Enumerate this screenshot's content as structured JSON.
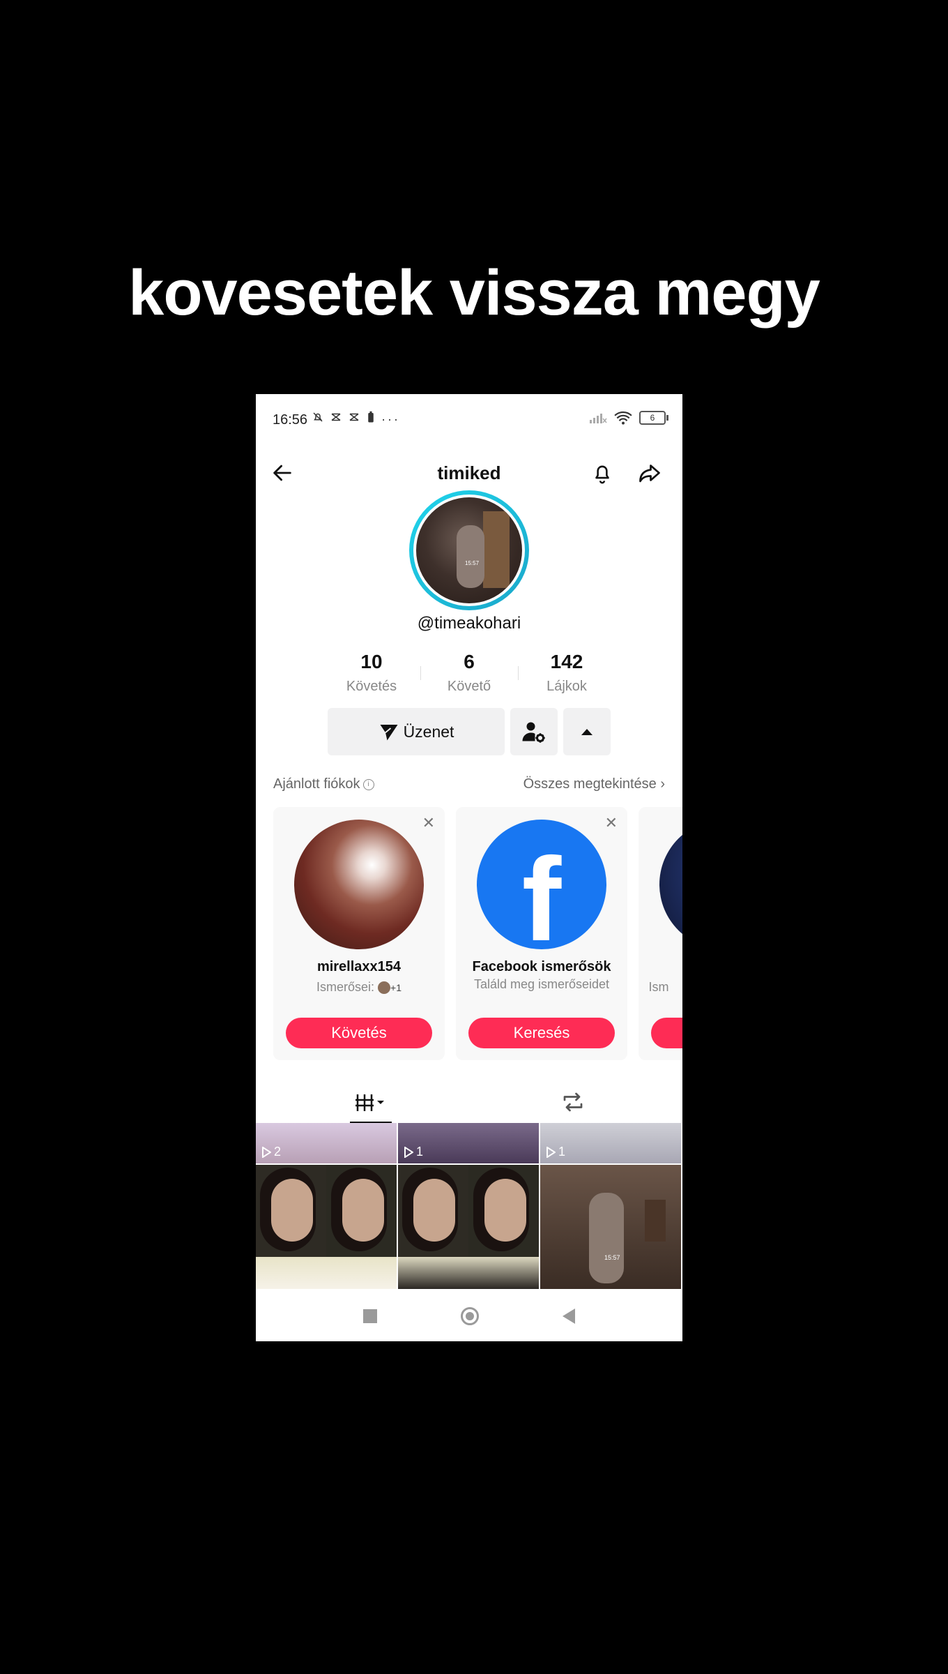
{
  "caption": "kovesetek vissza megy",
  "status": {
    "time": "16:56",
    "battery": "6"
  },
  "profile": {
    "title": "timiked",
    "handle": "@timeakohari",
    "avatar_timestamp": "15:57",
    "stats": [
      {
        "value": "10",
        "label": "Követés"
      },
      {
        "value": "6",
        "label": "Követő"
      },
      {
        "value": "142",
        "label": "Lájkok"
      }
    ],
    "message_label": "Üzenet"
  },
  "suggested": {
    "title": "Ajánlott fiókok",
    "see_all": "Összes megtekintése",
    "cards": [
      {
        "name": "mirellaxx154",
        "sub_prefix": "Ismerősei:",
        "sub_extra": "+1",
        "button": "Követés"
      },
      {
        "name": "Facebook ismerősök",
        "sub": "Találd meg ismerőseidet",
        "button": "Keresés"
      },
      {
        "name": "",
        "sub": "Ism"
      }
    ]
  },
  "grid": [
    {
      "plays": "2"
    },
    {
      "plays": "1"
    },
    {
      "plays": "1"
    }
  ],
  "grid_timestamp": "15:57",
  "colors": {
    "accent": "#fe2c55",
    "ring": "#20d5ec",
    "facebook": "#1877f2"
  }
}
